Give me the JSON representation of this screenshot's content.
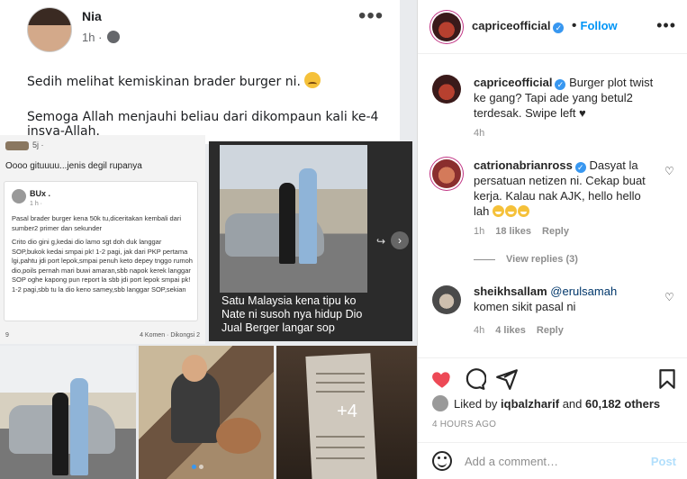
{
  "post_image": {
    "fb_name": "Nia",
    "fb_time": "1h ·",
    "fb_line1": "Sedih melihat kemiskinan brader burger ni.",
    "fb_line2": "Semoga Allah menjauhi beliau dari dikompaun kali ke-4 insya-Allah.",
    "sub_head": "5j ·",
    "sub_title": "Oooo gituuuu...jenis degil rupanya",
    "inner_name": "BUx .",
    "inner_time": "1 h · ",
    "inner_p1": "Pasal brader burger kena 50k tu,diceritakan kembali dari sumber2 primer dan sekunder",
    "inner_p2": "Crito dio gini g,kedai dio lamo sgt doh duk langgar SOP,bukok kedai smpai pk! 1-2 pagi, jak dari PKP pertama lgi,pahtu jdi port lepok,smpai penuh keto depey tnggo rumoh dio,poils pernah mari buwi amaran,sbb napok kerek langgar SOP oghe kapong pun report la sbb jdi port lepok smpai pk! 1-2 pagi,sbb tu la dio keno samey,sbb langgar SOP,sekian",
    "sub_foot_left": "9",
    "sub_foot_right": "4 Komen · Dikongsi 2",
    "caption_overlay": "Satu Malaysia kena tipu ko Nate ni susoh nya hidup Dio Jual Berger langar sop",
    "more_count": "+4"
  },
  "header": {
    "username": "capriceofficial",
    "follow_label": "Follow",
    "more_label": "•••"
  },
  "comments": [
    {
      "username": "capriceofficial",
      "text": "Burger plot twist ke gang? Tapi ade yang betul2 terdesak. Swipe left ♥",
      "time": "4h"
    },
    {
      "username": "catrionabrianross",
      "text": "Dasyat la persatuan netizen ni. Cekap buat kerja. Kalau nak AJK, hello hello lah",
      "time": "1h",
      "likes": "18 likes",
      "reply": "Reply",
      "view_replies": "View replies (3)"
    },
    {
      "username": "sheikhsallam",
      "mention": "@erulsamah",
      "text": "komen sikit pasal ni",
      "time": "4h",
      "likes": "4 likes",
      "reply": "Reply"
    }
  ],
  "likes_text_prefix": "Liked by",
  "likes_user": "iqbalzharif",
  "likes_and": "and",
  "likes_count": "60,182 others",
  "time_ago": "4 HOURS AGO",
  "add_comment_placeholder": "Add a comment…",
  "post_button": "Post",
  "colors": {
    "accent": "#0095f6",
    "like_red": "#ed4956",
    "verified": "#3897f0"
  }
}
